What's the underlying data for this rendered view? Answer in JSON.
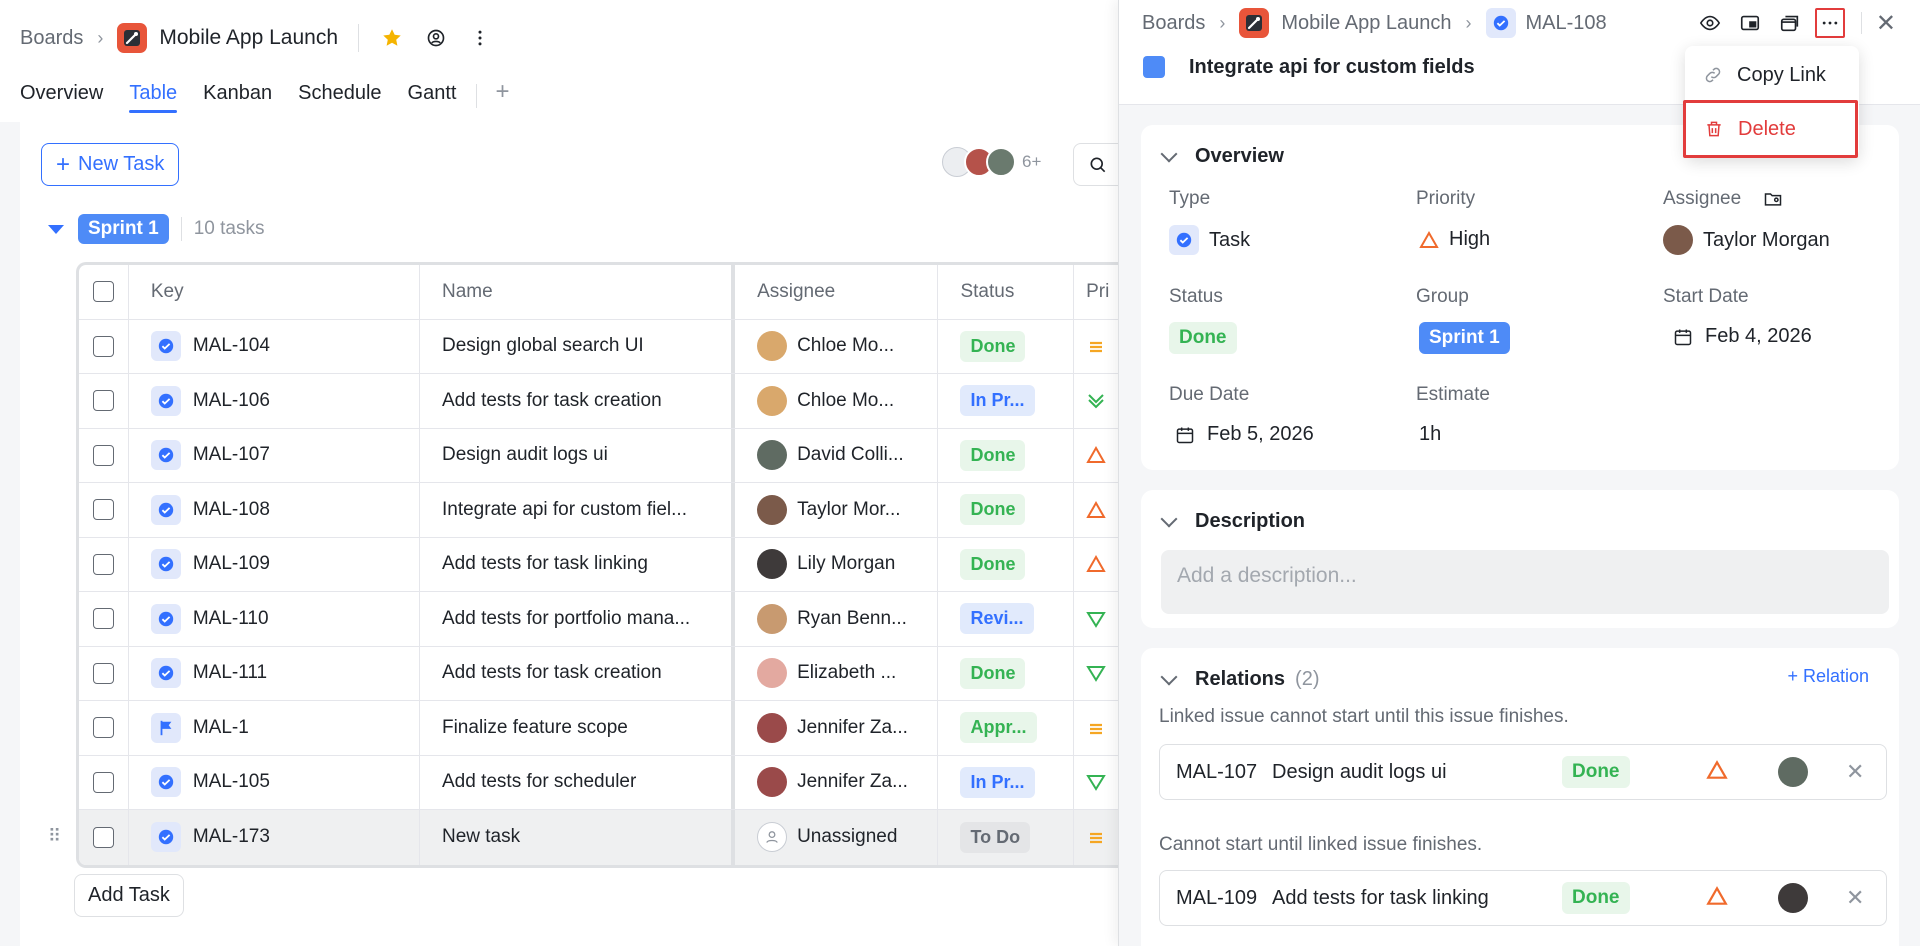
{
  "breadcrumb": {
    "root": "Boards",
    "project": "Mobile App Launch"
  },
  "view_tabs": [
    "Overview",
    "Table",
    "Kanban",
    "Schedule",
    "Gantt"
  ],
  "active_tab": "Table",
  "toolbar": {
    "new_task": "New Task",
    "avatar_more": "6+"
  },
  "group": {
    "name": "Sprint 1",
    "count": "10 tasks"
  },
  "table": {
    "columns": [
      "Key",
      "Name",
      "Assignee",
      "Status",
      "Pri"
    ],
    "rows": [
      {
        "key": "MAL-104",
        "name": "Design global search UI",
        "assignee": "Chloe Mo...",
        "status": "Done",
        "type": "task"
      },
      {
        "key": "MAL-106",
        "name": "Add tests for task creation",
        "assignee": "Chloe Mo...",
        "status": "In Pr...",
        "type": "task"
      },
      {
        "key": "MAL-107",
        "name": "Design audit logs ui",
        "assignee": "David Colli...",
        "status": "Done",
        "type": "task"
      },
      {
        "key": "MAL-108",
        "name": "Integrate api for custom fiel...",
        "assignee": "Taylor Mor...",
        "status": "Done",
        "type": "task"
      },
      {
        "key": "MAL-109",
        "name": "Add tests for task linking",
        "assignee": "Lily Morgan",
        "status": "Done",
        "type": "task"
      },
      {
        "key": "MAL-110",
        "name": "Add tests for portfolio mana...",
        "assignee": "Ryan Benn...",
        "status": "Revi...",
        "type": "task"
      },
      {
        "key": "MAL-111",
        "name": "Add tests for task creation",
        "assignee": "Elizabeth ...",
        "status": "Done",
        "type": "task"
      },
      {
        "key": "MAL-1",
        "name": "Finalize feature scope",
        "assignee": "Jennifer Za...",
        "status": "Appr...",
        "type": "milestone"
      },
      {
        "key": "MAL-105",
        "name": "Add tests for scheduler",
        "assignee": "Jennifer Za...",
        "status": "In Pr...",
        "type": "task"
      },
      {
        "key": "MAL-173",
        "name": "New task",
        "assignee": "Unassigned",
        "status": "To Do",
        "type": "task"
      }
    ]
  },
  "add_task": "Add Task",
  "panel": {
    "breadcrumb": {
      "root": "Boards",
      "project": "Mobile App Launch",
      "key": "MAL-108"
    },
    "title": "Integrate api for custom fields",
    "overview": {
      "heading": "Overview",
      "type_label": "Type",
      "type_value": "Task",
      "priority_label": "Priority",
      "priority_value": "High",
      "assignee_label": "Assignee",
      "assignee_value": "Taylor Morgan",
      "status_label": "Status",
      "status_value": "Done",
      "group_label": "Group",
      "group_value": "Sprint 1",
      "start_label": "Start Date",
      "start_value": "Feb 4, 2026",
      "due_label": "Due Date",
      "due_value": "Feb 5, 2026",
      "estimate_label": "Estimate",
      "estimate_value": "1h"
    },
    "description": {
      "heading": "Description",
      "placeholder": "Add a description..."
    },
    "relations": {
      "heading": "Relations",
      "count": "(2)",
      "add": "+ Relation",
      "note1": "Linked issue cannot start until this issue finishes.",
      "item1": {
        "key": "MAL-107",
        "name": "Design audit logs ui",
        "status": "Done"
      },
      "note2": "Cannot start until linked issue finishes.",
      "item2": {
        "key": "MAL-109",
        "name": "Add tests for task linking",
        "status": "Done"
      }
    }
  },
  "menu": {
    "copy": "Copy Link",
    "delete": "Delete"
  },
  "colors": {
    "accent": "#3370ff",
    "danger": "#e23c3c",
    "done": "#34b353",
    "brand_logo": "#e8553a"
  }
}
